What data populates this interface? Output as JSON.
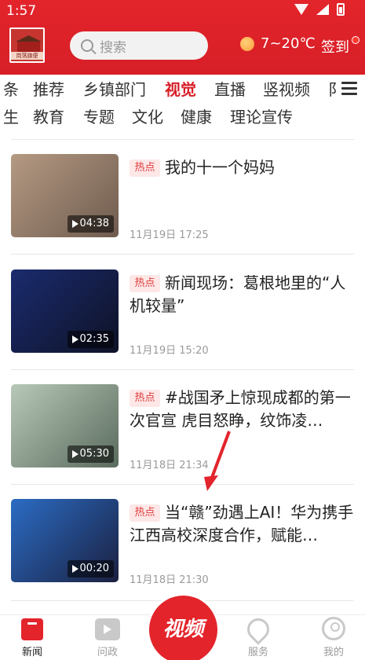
{
  "status": {
    "time": "1:57"
  },
  "header": {
    "logo_text": "岗落旗便",
    "search_placeholder": "搜索",
    "weather": "7~20℃",
    "checkin": "签到"
  },
  "tabs": {
    "row1": [
      "条",
      "推荐",
      "乡镇部门",
      "视觉",
      "直播",
      "竖视频",
      "阝"
    ],
    "row2": [
      "生",
      "教育",
      "专题",
      "文化",
      "健康",
      "理论宣传"
    ],
    "active": "视觉"
  },
  "news": [
    {
      "badge": "热点",
      "title": "我的十一个妈妈",
      "date": "11月19日 17:25",
      "duration": "04:38",
      "thumb_colors": [
        "#b59a83",
        "#6e5b4e"
      ]
    },
    {
      "badge": "热点",
      "title": "新闻现场：葛根地里的“人机较量”",
      "date": "11月19日 15:20",
      "duration": "02:35",
      "thumb_colors": [
        "#1b2b6e",
        "#0e1226"
      ]
    },
    {
      "badge": "热点",
      "title": "#战国矛上惊现成都的第一次官宣 虎目怒睁，纹饰凌…",
      "date": "11月18日 21:34",
      "duration": "05:30",
      "thumb_colors": [
        "#b8c8b8",
        "#596b5d"
      ]
    },
    {
      "badge": "热点",
      "title": "当“赣”劲遇上AI！华为携手江西高校深度合作，赋能…",
      "date": "11月18日 21:30",
      "duration": "00:20",
      "thumb_colors": [
        "#2b6cc4",
        "#1b2040"
      ]
    }
  ],
  "bottom_nav": [
    {
      "label": "新闻",
      "icon": "news-icon"
    },
    {
      "label": "问政",
      "icon": "ask-icon"
    },
    {
      "label": "视频",
      "icon": "video-center-icon"
    },
    {
      "label": "服务",
      "icon": "service-icon"
    },
    {
      "label": "我的",
      "icon": "me-icon"
    }
  ],
  "colors": {
    "brand_red": "#e3242b",
    "badge_bg": "#fde7e7",
    "badge_text": "#e03a3a"
  }
}
